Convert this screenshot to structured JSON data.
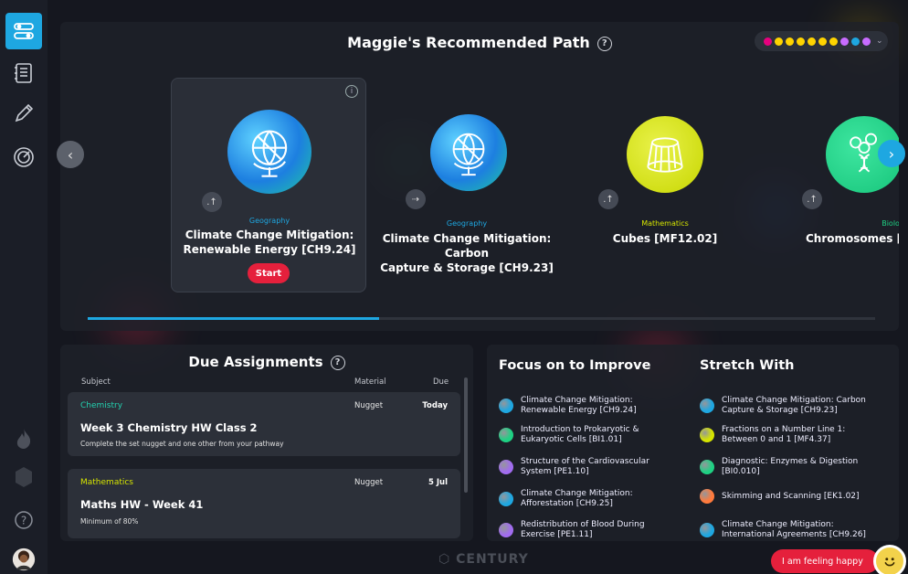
{
  "path": {
    "title": "Maggie's Recommended Path",
    "help": "?",
    "info": "i",
    "filter_dots": [
      "#e6007e",
      "#ffd400",
      "#ffd400",
      "#ffd400",
      "#ffd400",
      "#ffd400",
      "#ffd400",
      "#c86cff",
      "#1ea7e1",
      "#c86cff"
    ],
    "nuggets": [
      {
        "subject": "Geography",
        "title_l1": "Climate Change Mitigation:",
        "title_l2": "Renewable Energy [CH9.24]",
        "start": "Start",
        "subject_color": "#1ea7e1"
      },
      {
        "subject": "Geography",
        "title_l1": "Climate Change Mitigation: Carbon",
        "title_l2": "Capture & Storage [CH9.23]",
        "subject_color": "#1ea7e1"
      },
      {
        "subject": "Mathematics",
        "title_l1": "Cubes [MF12.02]",
        "title_l2": "",
        "subject_color": "#d5e400"
      },
      {
        "subject": "Biology",
        "title_l1": "Chromosomes [E",
        "title_l2": "",
        "subject_color": "#1ed183"
      }
    ],
    "progress": 0.37
  },
  "assignments": {
    "title": "Due Assignments",
    "help": "?",
    "headers": {
      "subject": "Subject",
      "material": "Material",
      "due": "Due"
    },
    "items": [
      {
        "subject": "Chemistry",
        "subject_color": "#23d2b0",
        "material": "Nugget",
        "due": "Today",
        "title": "Week 3 Chemistry HW Class 2",
        "desc": "Complete the set nugget and one other from your pathway"
      },
      {
        "subject": "Mathematics",
        "subject_color": "#d5e400",
        "material": "Nugget",
        "due": "5 Jul",
        "title": "Maths HW - Week 41",
        "desc": "Minimum of 80%"
      }
    ]
  },
  "focus": {
    "title": "Focus on to Improve",
    "items": [
      {
        "l1": "Climate Change Mitigation:",
        "l2": "Renewable Energy [CH9.24]",
        "color": "#1ea7e1"
      },
      {
        "l1": "Introduction to Prokaryotic &",
        "l2": "Eukaryotic Cells [BI1.01]",
        "color": "#1ed183"
      },
      {
        "l1": "Structure of the Cardiovascular",
        "l2": "System [PE1.10]",
        "color": "#a16cf0"
      },
      {
        "l1": "Climate Change Mitigation:",
        "l2": "Afforestation [CH9.25]",
        "color": "#1ea7e1"
      },
      {
        "l1": "Redistribution of Blood During",
        "l2": "Exercise [PE1.11]",
        "color": "#a16cf0"
      }
    ]
  },
  "stretch": {
    "title": "Stretch With",
    "items": [
      {
        "l1": "Climate Change Mitigation: Carbon",
        "l2": "Capture & Storage [CH9.23]",
        "color": "#1ea7e1"
      },
      {
        "l1": "Fractions on a Number Line 1:",
        "l2": "Between 0 and 1 [MF4.37]",
        "color": "#d5e400"
      },
      {
        "l1": "Diagnostic: Enzymes & Digestion",
        "l2": "[BI0.010]",
        "color": "#1ed183"
      },
      {
        "l1": "Skimming and Scanning [EK1.02]",
        "l2": "",
        "color": "#ff7a3c"
      },
      {
        "l1": "Climate Change Mitigation:",
        "l2": "International Agreements [CH9.26]",
        "color": "#1ea7e1"
      }
    ]
  },
  "footer": {
    "brand": "CENTURY",
    "feeling": "I am feeling happy"
  }
}
